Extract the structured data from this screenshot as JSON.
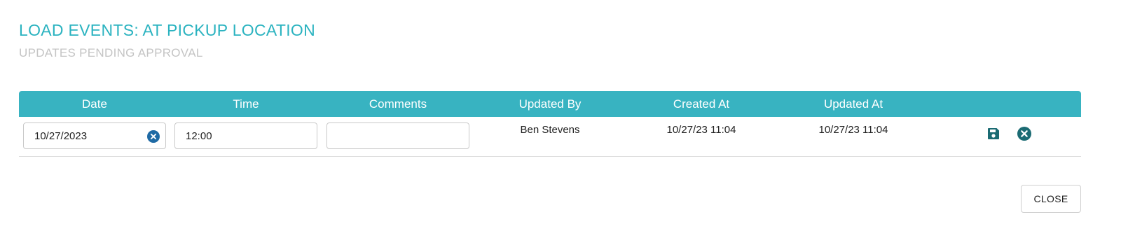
{
  "modal": {
    "title": "LOAD EVENTS: AT PICKUP LOCATION",
    "subtitle": "UPDATES PENDING APPROVAL"
  },
  "table": {
    "columns": [
      "Date",
      "Time",
      "Comments",
      "Updated By",
      "Created At",
      "Updated At"
    ],
    "rows": [
      {
        "date": "10/27/2023",
        "time": "12:00",
        "comments": "",
        "updated_by": "Ben Stevens",
        "created_at": "10/27/23 11:04",
        "updated_at": "10/27/23 11:04"
      }
    ]
  },
  "icons": {
    "clear_date": "clear-circle-icon",
    "save": "save-icon",
    "cancel": "cancel-circle-icon"
  },
  "colors": {
    "accent": "#2bb3c0",
    "header_bg": "#38b3c1",
    "subtitle": "#c4c4c4",
    "icon_dark_teal": "#1b6b73",
    "clear_icon": "#1f6aa5"
  },
  "footer": {
    "close_label": "CLOSE"
  }
}
